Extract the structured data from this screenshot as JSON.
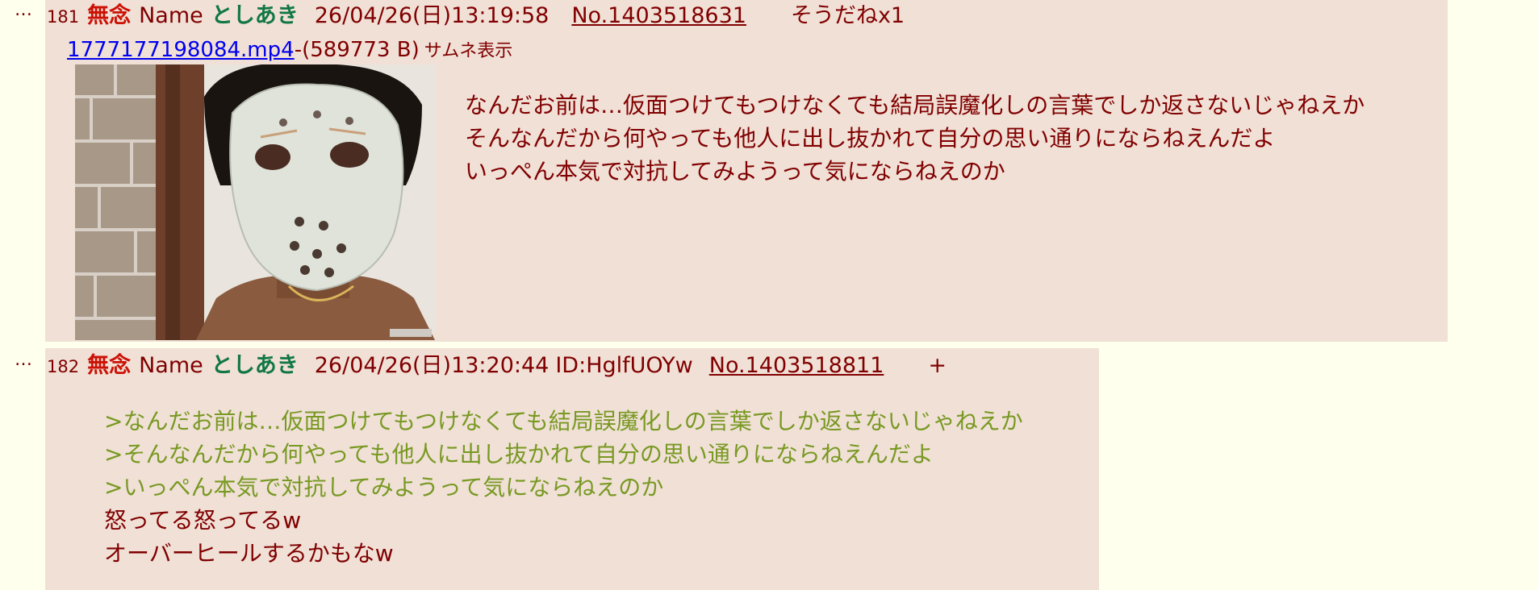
{
  "posts": [
    {
      "num": "181",
      "subject": "無念",
      "name_label": "Name",
      "name": "としあき",
      "datetime": "26/04/26(日)13:19:58",
      "post_no": "No.1403518631",
      "sodane": "そうだねx1",
      "file": {
        "link": "1777177198084.mp4",
        "size": "-(589773 B)",
        "thumb_toggle": "サムネ表示"
      },
      "lines": [
        "なんだお前は…仮面つけてもつけなくても結局誤魔化しの言葉でしか返さないじゃねえか",
        "そんなんだから何やっても他人に出し抜かれて自分の思い通りにならねえんだよ",
        "いっぺん本気で対抗してみようって気にならねえのか"
      ]
    },
    {
      "num": "182",
      "subject": "無念",
      "name_label": "Name",
      "name": "としあき",
      "datetime": "26/04/26(日)13:20:44",
      "id": "ID:HglfUOYw",
      "post_no": "No.1403518811",
      "sodane": "+",
      "quotes": [
        ">なんだお前は…仮面つけてもつけなくても結局誤魔化しの言葉でしか返さないじゃねえか",
        ">そんなんだから何やっても他人に出し抜かれて自分の思い通りにならねえんだよ",
        ">いっぺん本気で対抗してみようって気にならねえのか"
      ],
      "lines": [
        "怒ってる怒ってるw",
        "オーバーヒールするかもなw"
      ]
    }
  ],
  "menu_glyph": "…"
}
